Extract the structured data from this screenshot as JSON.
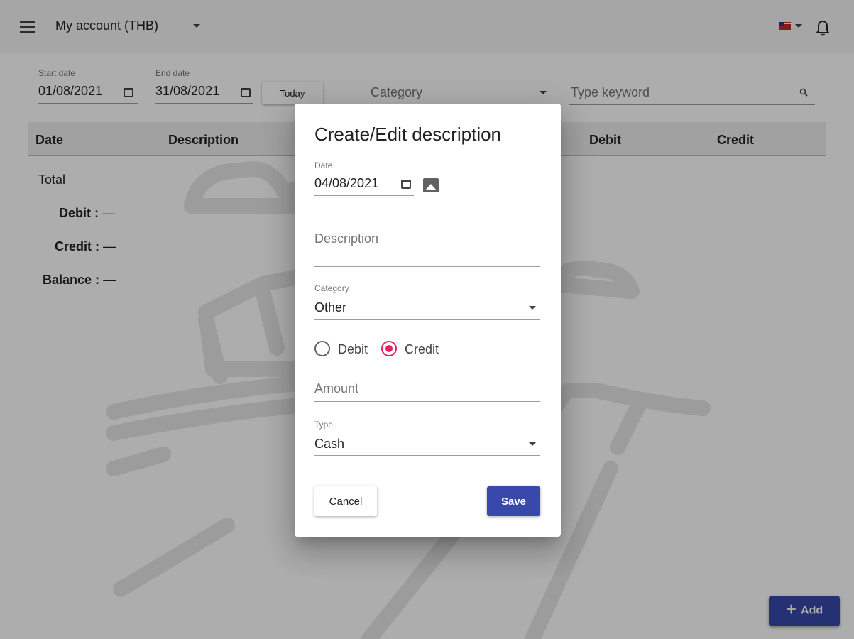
{
  "header": {
    "account_selector": "My account (THB)",
    "menu_icon": "hamburger-menu-icon",
    "flag_icon": "us-flag-icon",
    "notification_icon": "bell-icon"
  },
  "filters": {
    "start_date_label": "Start date",
    "start_date": "01/08/2021",
    "end_date_label": "End date",
    "end_date": "31/08/2021",
    "today_label": "Today",
    "category_placeholder": "Category",
    "keyword_placeholder": "Type keyword"
  },
  "table": {
    "columns": [
      "Date",
      "Description",
      "Debit",
      "Credit"
    ]
  },
  "totals": {
    "title": "Total",
    "debit_label": "Debit :",
    "debit_value": "—",
    "credit_label": "Credit :",
    "credit_value": "—",
    "balance_label": "Balance :",
    "balance_value": "—"
  },
  "add_button": {
    "label": "Add",
    "icon": "plus-icon"
  },
  "dialog": {
    "title": "Create/Edit description",
    "date_label": "Date",
    "date_value": "04/08/2021",
    "description_placeholder": "Description",
    "category_label": "Category",
    "category_value": "Other",
    "entry_type": {
      "options": [
        "Debit",
        "Credit"
      ],
      "selected": "Credit"
    },
    "amount_placeholder": "Amount",
    "type_label": "Type",
    "type_value": "Cash",
    "cancel_label": "Cancel",
    "save_label": "Save"
  },
  "colors": {
    "primary": "#3949ab",
    "accent": "#e91e63",
    "scrim": "rgba(0,0,0,0.32)"
  }
}
